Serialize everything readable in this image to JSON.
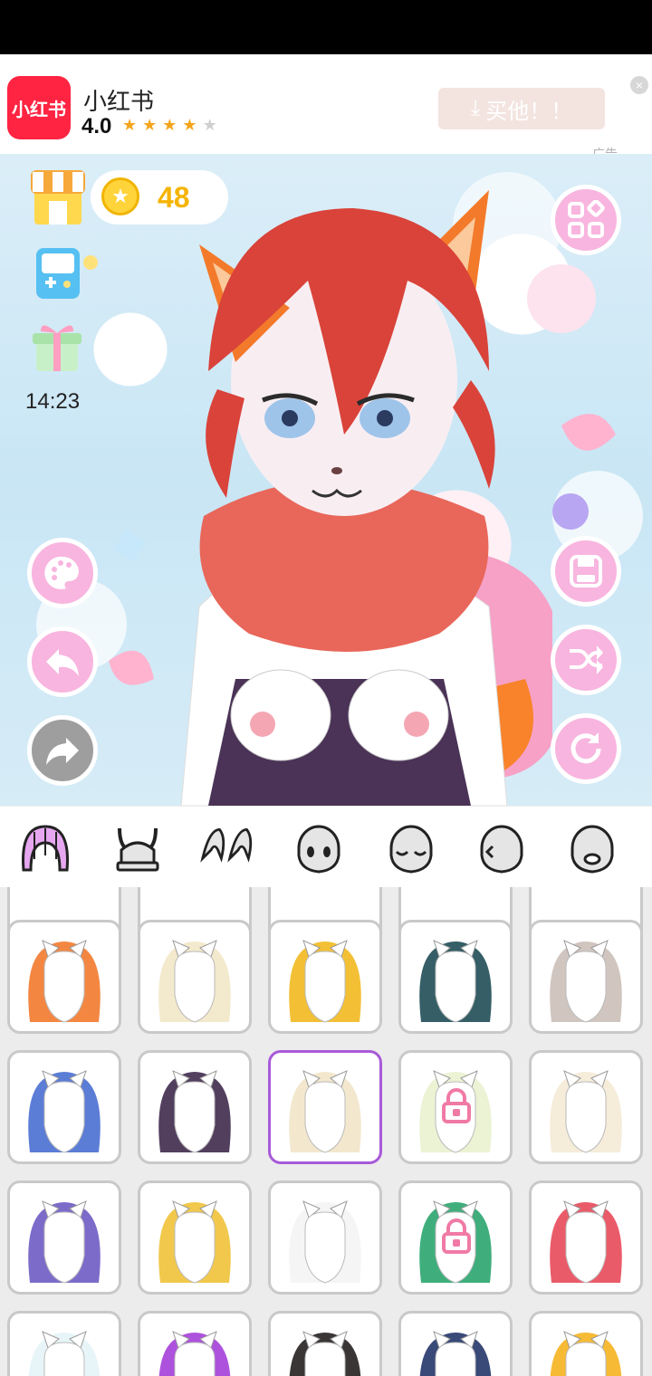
{
  "ad": {
    "logo_text": "小红书",
    "app_name": "小红书",
    "rating": "4.0",
    "stars_on": 4,
    "stars_total": 5,
    "button_label": "买他！！",
    "button_icon": "download-icon",
    "close_label": "×",
    "ad_tag": "广告"
  },
  "hud": {
    "coins": "48",
    "timer": "14:23"
  },
  "left_buttons": [
    "palette-icon",
    "undo-icon",
    "redo-icon"
  ],
  "right_buttons": [
    "grid-menu-icon",
    "save-icon",
    "shuffle-icon",
    "reset-icon"
  ],
  "tabs": [
    "hair",
    "horns",
    "ears",
    "face-base",
    "face-closed-eyes",
    "face-side",
    "face-mouth"
  ],
  "grid": {
    "selected_index": 7,
    "items": [
      {
        "name": "hair-orange-braids",
        "color": "#f27a2e",
        "locked": false
      },
      {
        "name": "hair-blonde-spiky",
        "color": "#f2e7c6",
        "locked": false
      },
      {
        "name": "hair-black-gold-headdress",
        "color": "#f2b91f",
        "locked": false
      },
      {
        "name": "hair-teal-tentacles",
        "color": "#1f4d55",
        "locked": false
      },
      {
        "name": "hair-grey-long",
        "color": "#cbbfb8",
        "locked": false
      },
      {
        "name": "hair-blue-bandana",
        "color": "#4a6fd1",
        "locked": false
      },
      {
        "name": "hair-dark-purple",
        "color": "#3f2a4d",
        "locked": false
      },
      {
        "name": "hair-cream-messy",
        "color": "#f2e6c9",
        "locked": false
      },
      {
        "name": "hair-mint-fluffy",
        "color": "#e9f2cf",
        "locked": true
      },
      {
        "name": "hair-cream-curly",
        "color": "#f4ead6",
        "locked": false
      },
      {
        "name": "hair-purple-spiky",
        "color": "#6f5bc4",
        "locked": false
      },
      {
        "name": "hair-blonde-turban",
        "color": "#f0c238",
        "locked": false
      },
      {
        "name": "hair-white-short",
        "color": "#f4f4f4",
        "locked": false
      },
      {
        "name": "hair-green-spiky",
        "color": "#2aa56e",
        "locked": true
      },
      {
        "name": "hair-red-spiky",
        "color": "#e8495a",
        "locked": false
      },
      {
        "name": "hair-white-fluffy",
        "color": "#e6f4f7",
        "locked": false
      },
      {
        "name": "hair-purple-bun",
        "color": "#a43fd8",
        "locked": false
      },
      {
        "name": "hair-black-bob",
        "color": "#262020",
        "locked": false
      },
      {
        "name": "hair-navy-spiky",
        "color": "#233569",
        "locked": false
      },
      {
        "name": "hair-golden-fringe",
        "color": "#f5b21f",
        "locked": false
      }
    ]
  }
}
